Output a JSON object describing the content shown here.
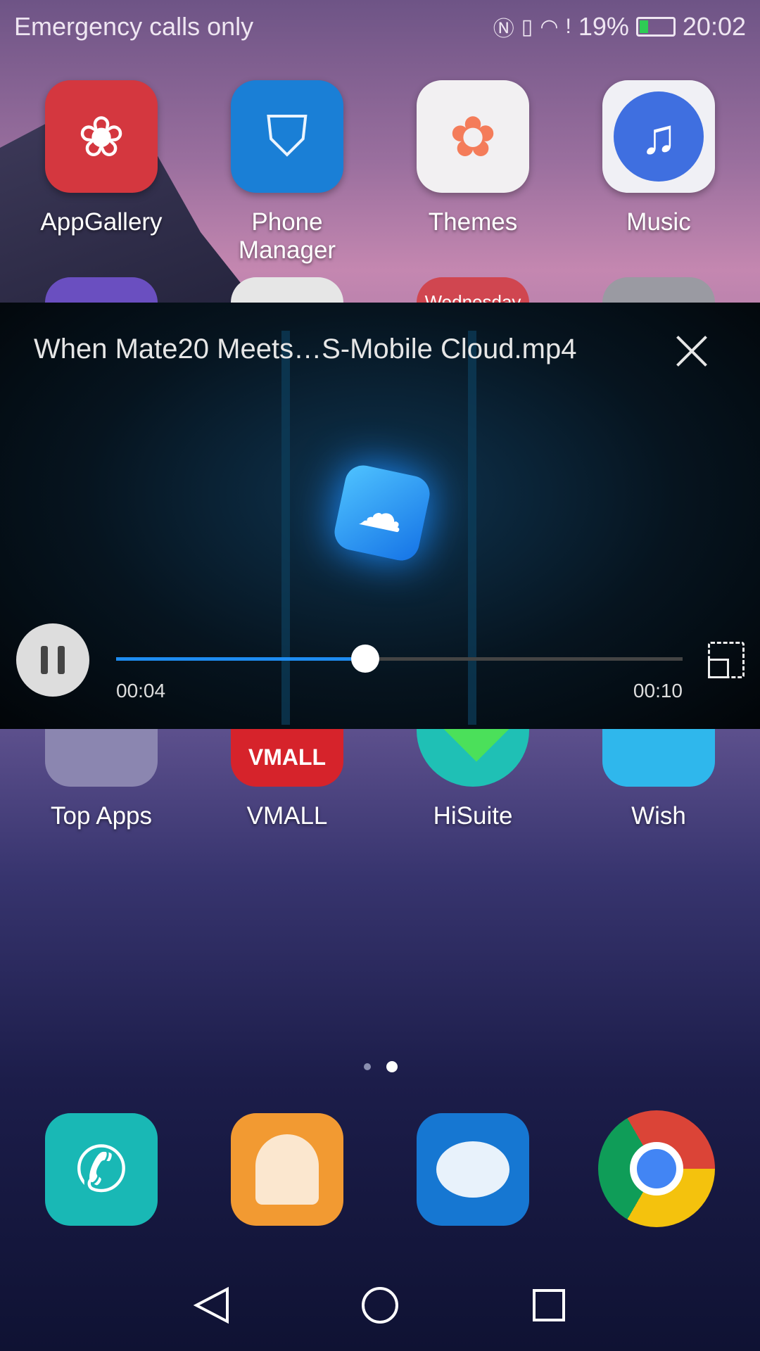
{
  "status_bar": {
    "carrier": "Emergency calls only",
    "battery": "19%",
    "battery_level": 0.19,
    "time": "20:02",
    "icons": [
      "nfc-icon",
      "vibrate-icon",
      "wifi-icon",
      "sim-alert-icon",
      "battery-charging-icon"
    ]
  },
  "home_row1": [
    {
      "label": "AppGallery",
      "color": "#d4373f",
      "icon": "huawei-bag-icon"
    },
    {
      "label": "Phone Manager",
      "color": "#1a7fd6",
      "icon": "shield-icon"
    },
    {
      "label": "Themes",
      "color": "#f2f0f2",
      "icon": "flower-icon"
    },
    {
      "label": "Music",
      "color": "#f0f0f5",
      "icon": "music-note-icon"
    }
  ],
  "home_row2_partial": {
    "calendar_text": "Wednesday"
  },
  "home_row3": [
    {
      "label": "Top Apps",
      "color": "#8b86b0"
    },
    {
      "label": "VMALL",
      "color": "#d6232b",
      "icon_text": "VMALL"
    },
    {
      "label": "HiSuite",
      "color": "#1fc0b5"
    },
    {
      "label": "Wish",
      "color": "#2fb7ec"
    }
  ],
  "video": {
    "title": "When Mate20 Meets…S-Mobile Cloud.mp4",
    "current_time": "00:04",
    "duration": "00:10",
    "progress": 0.44,
    "accent": "#1e8cf0"
  },
  "page_indicator": {
    "pages": 2,
    "current": 2
  },
  "dock": [
    {
      "name": "phone",
      "color": "#19b8b5"
    },
    {
      "name": "contacts",
      "color": "#f29a32"
    },
    {
      "name": "messages",
      "color": "#1677d2"
    },
    {
      "name": "chrome",
      "color": "#ffffff"
    }
  ]
}
